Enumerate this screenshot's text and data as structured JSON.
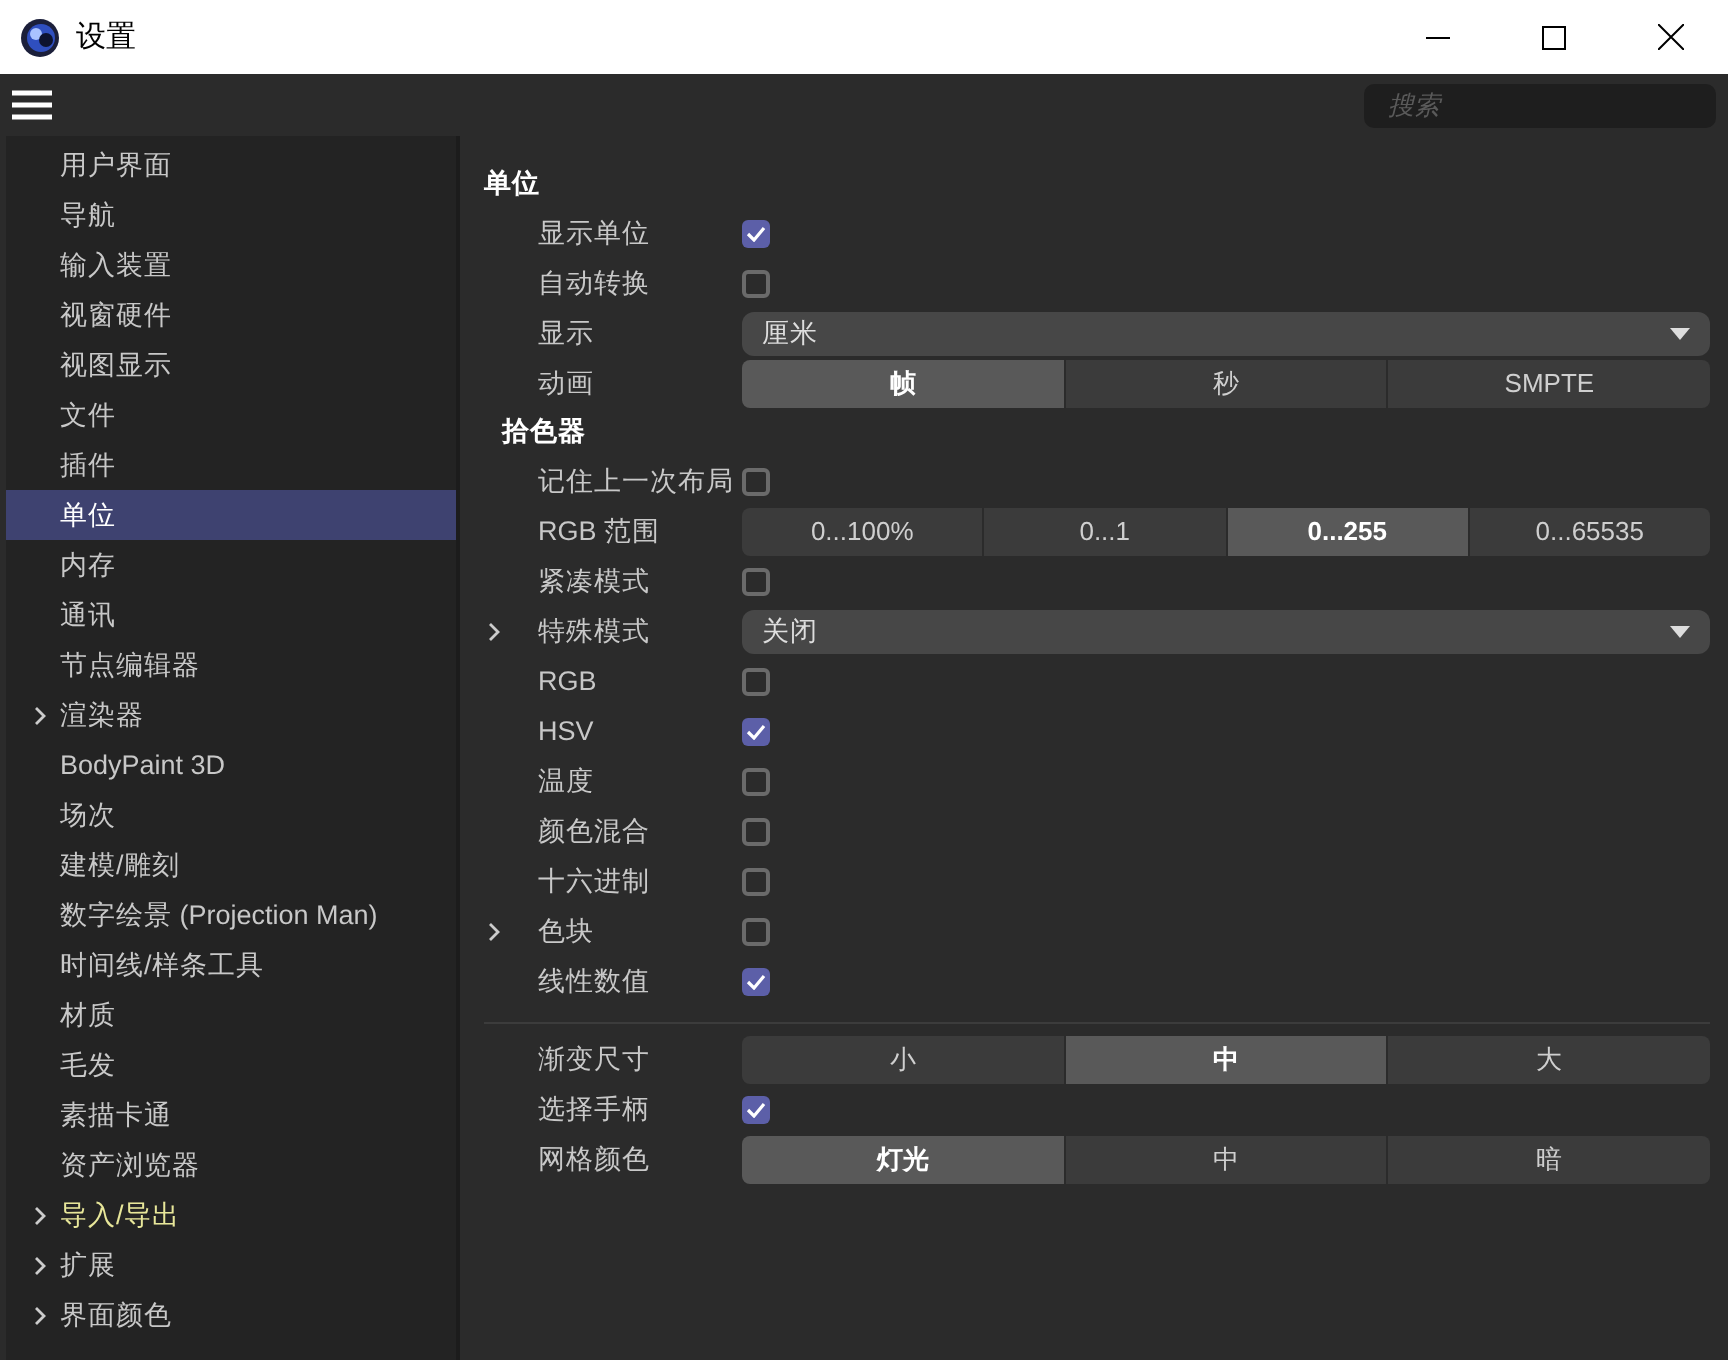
{
  "window": {
    "title": "设置"
  },
  "search": {
    "placeholder": "搜索"
  },
  "sidebar": {
    "items": [
      {
        "label": "用户界面",
        "selected": false,
        "expandable": false,
        "highlighted": false
      },
      {
        "label": "导航",
        "selected": false,
        "expandable": false,
        "highlighted": false
      },
      {
        "label": "输入装置",
        "selected": false,
        "expandable": false,
        "highlighted": false
      },
      {
        "label": "视窗硬件",
        "selected": false,
        "expandable": false,
        "highlighted": false
      },
      {
        "label": "视图显示",
        "selected": false,
        "expandable": false,
        "highlighted": false
      },
      {
        "label": "文件",
        "selected": false,
        "expandable": false,
        "highlighted": false
      },
      {
        "label": "插件",
        "selected": false,
        "expandable": false,
        "highlighted": false
      },
      {
        "label": "单位",
        "selected": true,
        "expandable": false,
        "highlighted": false
      },
      {
        "label": "内存",
        "selected": false,
        "expandable": false,
        "highlighted": false
      },
      {
        "label": "通讯",
        "selected": false,
        "expandable": false,
        "highlighted": false
      },
      {
        "label": "节点编辑器",
        "selected": false,
        "expandable": false,
        "highlighted": false
      },
      {
        "label": "渲染器",
        "selected": false,
        "expandable": true,
        "highlighted": false
      },
      {
        "label": "BodyPaint 3D",
        "selected": false,
        "expandable": false,
        "highlighted": false
      },
      {
        "label": "场次",
        "selected": false,
        "expandable": false,
        "highlighted": false
      },
      {
        "label": "建模/雕刻",
        "selected": false,
        "expandable": false,
        "highlighted": false
      },
      {
        "label": "数字绘景 (Projection Man)",
        "selected": false,
        "expandable": false,
        "highlighted": false
      },
      {
        "label": "时间线/样条工具",
        "selected": false,
        "expandable": false,
        "highlighted": false
      },
      {
        "label": "材质",
        "selected": false,
        "expandable": false,
        "highlighted": false
      },
      {
        "label": "毛发",
        "selected": false,
        "expandable": false,
        "highlighted": false
      },
      {
        "label": "素描卡通",
        "selected": false,
        "expandable": false,
        "highlighted": false
      },
      {
        "label": "资产浏览器",
        "selected": false,
        "expandable": false,
        "highlighted": false
      },
      {
        "label": "导入/导出",
        "selected": false,
        "expandable": true,
        "highlighted": true
      },
      {
        "label": "扩展",
        "selected": false,
        "expandable": true,
        "highlighted": false
      },
      {
        "label": "界面颜色",
        "selected": false,
        "expandable": true,
        "highlighted": false
      }
    ]
  },
  "sections": [
    {
      "title": "单位",
      "rows": [
        {
          "kind": "checkbox",
          "label": "显示单位",
          "checked": true,
          "expandable": false
        },
        {
          "kind": "checkbox",
          "label": "自动转换",
          "checked": false,
          "expandable": false
        },
        {
          "kind": "dropdown",
          "label": "显示",
          "value": "厘米",
          "expandable": false
        },
        {
          "kind": "segmented",
          "label": "动画",
          "options": [
            {
              "label": "帧",
              "selected": true
            },
            {
              "label": "秒",
              "selected": false
            },
            {
              "label": "SMPTE",
              "selected": false
            }
          ]
        }
      ]
    },
    {
      "title": "拾色器",
      "rows": [
        {
          "kind": "checkbox",
          "label": "记住上一次布局",
          "checked": false,
          "expandable": false
        },
        {
          "kind": "segmented",
          "label": "RGB 范围",
          "options": [
            {
              "label": "0...100%",
              "selected": false
            },
            {
              "label": "0...1",
              "selected": false
            },
            {
              "label": "0...255",
              "selected": true
            },
            {
              "label": "0...65535",
              "selected": false
            }
          ]
        },
        {
          "kind": "checkbox",
          "label": "紧凑模式",
          "checked": false,
          "expandable": false
        },
        {
          "kind": "dropdown",
          "label": "特殊模式",
          "value": "关闭",
          "expandable": true
        },
        {
          "kind": "checkbox",
          "label": "RGB",
          "checked": false,
          "expandable": false
        },
        {
          "kind": "checkbox",
          "label": "HSV",
          "checked": true,
          "expandable": false
        },
        {
          "kind": "checkbox",
          "label": "温度",
          "checked": false,
          "expandable": false
        },
        {
          "kind": "checkbox",
          "label": "颜色混合",
          "checked": false,
          "expandable": false
        },
        {
          "kind": "checkbox",
          "label": "十六进制",
          "checked": false,
          "expandable": false
        },
        {
          "kind": "checkbox",
          "label": "色块",
          "checked": false,
          "expandable": true
        },
        {
          "kind": "checkbox",
          "label": "线性数值",
          "checked": true,
          "expandable": false
        }
      ]
    },
    {
      "rows": [
        {
          "kind": "segmented",
          "label": "渐变尺寸",
          "options": [
            {
              "label": "小",
              "selected": false
            },
            {
              "label": "中",
              "selected": true
            },
            {
              "label": "大",
              "selected": false
            }
          ]
        },
        {
          "kind": "checkbox",
          "label": "选择手柄",
          "checked": true,
          "expandable": false
        },
        {
          "kind": "segmented",
          "label": "网格颜色",
          "options": [
            {
              "label": "灯光",
              "selected": true
            },
            {
              "label": "中",
              "selected": false
            },
            {
              "label": "暗",
              "selected": false
            }
          ]
        }
      ]
    }
  ]
}
